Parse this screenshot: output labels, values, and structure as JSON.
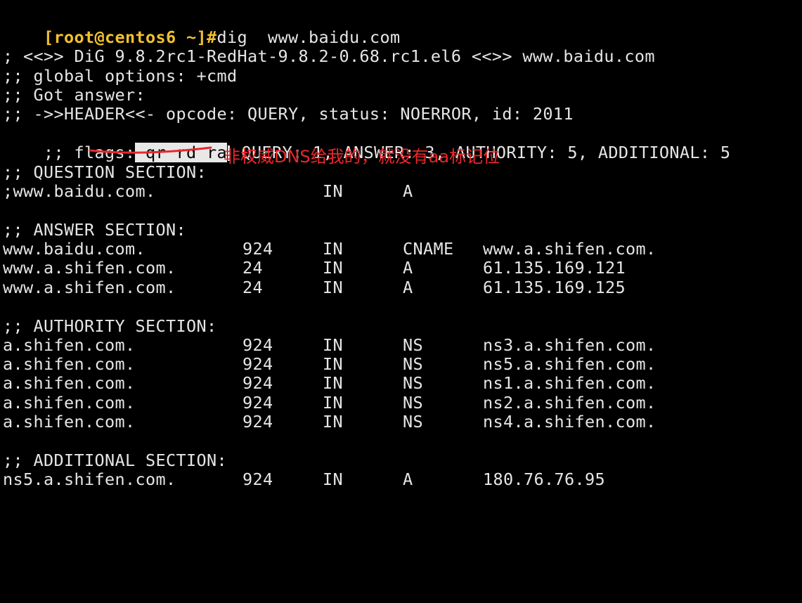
{
  "terminal": {
    "prompt": "[root@centos6 ~]#",
    "command": "dig  www.baidu.com",
    "banner": "; <<>> DiG 9.8.2rc1-RedHat-9.8.2-0.68.rc1.el6 <<>> www.baidu.com",
    "global_options": ";; global options: +cmd",
    "got_answer": ";; Got answer:",
    "header": ";; ->>HEADER<<- opcode: QUERY, status: NOERROR, id: 2011",
    "flags_prefix": ";; flags:",
    "flags_selected": " qr rd ra",
    "flags_suffix": " QUERY: 1, ANSWER: 3, AUTHORITY: 5, ADDITIONAL: 5",
    "question_header": ";; QUESTION SECTION:",
    "question": {
      "name": ";www.baidu.com.",
      "class": "IN",
      "type": "A"
    },
    "answer_header": ";; ANSWER SECTION:",
    "answer_rows": [
      {
        "name": "www.baidu.com.",
        "ttl": "924",
        "class": "IN",
        "type": "CNAME",
        "data": "www.a.shifen.com."
      },
      {
        "name": "www.a.shifen.com.",
        "ttl": "24",
        "class": "IN",
        "type": "A",
        "data": "61.135.169.121"
      },
      {
        "name": "www.a.shifen.com.",
        "ttl": "24",
        "class": "IN",
        "type": "A",
        "data": "61.135.169.125"
      }
    ],
    "authority_header": ";; AUTHORITY SECTION:",
    "authority_rows": [
      {
        "name": "a.shifen.com.",
        "ttl": "924",
        "class": "IN",
        "type": "NS",
        "data": "ns3.a.shifen.com."
      },
      {
        "name": "a.shifen.com.",
        "ttl": "924",
        "class": "IN",
        "type": "NS",
        "data": "ns5.a.shifen.com."
      },
      {
        "name": "a.shifen.com.",
        "ttl": "924",
        "class": "IN",
        "type": "NS",
        "data": "ns1.a.shifen.com."
      },
      {
        "name": "a.shifen.com.",
        "ttl": "924",
        "class": "IN",
        "type": "NS",
        "data": "ns2.a.shifen.com."
      },
      {
        "name": "a.shifen.com.",
        "ttl": "924",
        "class": "IN",
        "type": "NS",
        "data": "ns4.a.shifen.com."
      }
    ],
    "additional_header": ";; ADDITIONAL SECTION:",
    "additional_rows": [
      {
        "name": "ns5.a.shifen.com.",
        "ttl": "924",
        "class": "IN",
        "type": "A",
        "data": "180.76.76.95"
      }
    ]
  },
  "annotation": {
    "text": "非权威DNS给我的，就没有aa标记位",
    "color": "#e8282a"
  },
  "colors": {
    "background": "#000000",
    "text": "#e6e6e6",
    "prompt": "#f2c12e",
    "selection": "#e8e8e8"
  }
}
